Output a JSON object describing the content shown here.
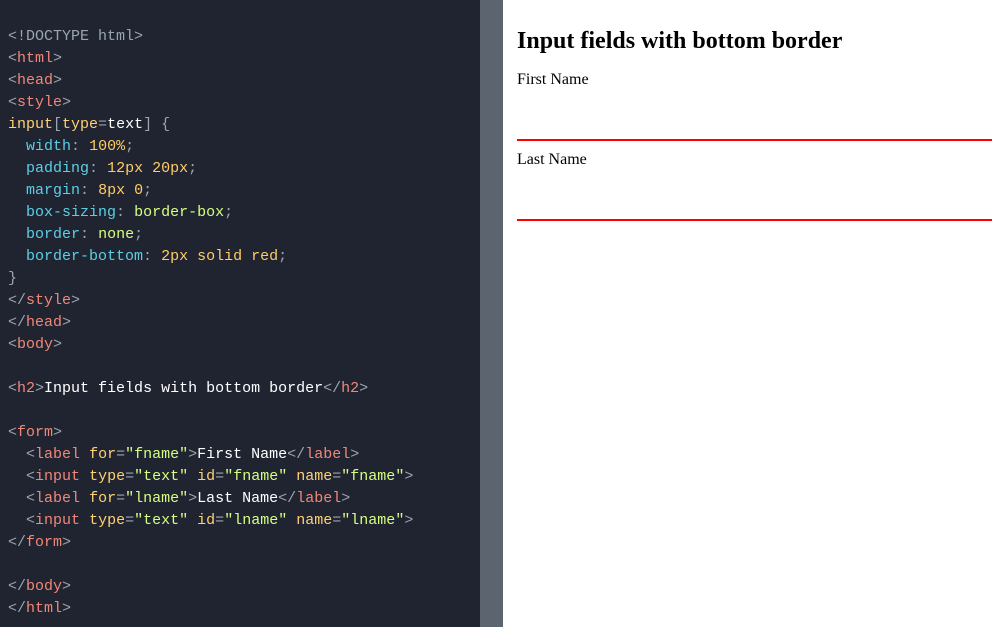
{
  "code": {
    "l01_doctype": "<!DOCTYPE html>",
    "l02_html_open": "html",
    "l03_head_open": "head",
    "l04_style_open": "style",
    "l05_selector_a": "input",
    "l05_selector_b": "type",
    "l05_selector_c": "text",
    "l06_prop": "width",
    "l06_val": "100%",
    "l07_prop": "padding",
    "l07_val": "12px 20px",
    "l08_prop": "margin",
    "l08_val": "8px 0",
    "l09_prop": "box-sizing",
    "l09_val": "border-box",
    "l10_prop": "border",
    "l10_val": "none",
    "l11_prop": "border-bottom",
    "l11_val": "2px solid red",
    "l13_style_close": "style",
    "l14_head_close": "head",
    "l15_body_open": "body",
    "l17_h2_open": "h2",
    "l17_h2_text": "Input fields with bottom border",
    "l19_form_open": "form",
    "l20_label": "label",
    "l20_for": "for",
    "l20_for_val": "fname",
    "l20_text": "First Name",
    "l21_input": "input",
    "l21_type": "type",
    "l21_type_val": "text",
    "l21_id": "id",
    "l21_id_val": "fname",
    "l21_name": "name",
    "l21_name_val": "fname",
    "l22_label": "label",
    "l22_for": "for",
    "l22_for_val": "lname",
    "l22_text": "Last Name",
    "l23_input": "input",
    "l23_type": "type",
    "l23_type_val": "text",
    "l23_id": "id",
    "l23_id_val": "lname",
    "l23_name": "name",
    "l23_name_val": "lname",
    "l24_form_close": "form",
    "l26_body_close": "body",
    "l27_html_close": "html"
  },
  "preview": {
    "heading": "Input fields with bottom border",
    "label_first": "First Name",
    "label_last": "Last Name"
  }
}
